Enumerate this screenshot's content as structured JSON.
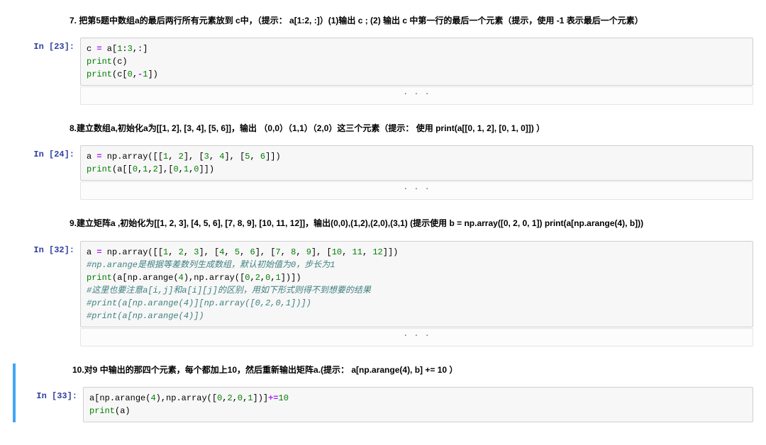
{
  "sections": [
    {
      "question": "7. 把第5题中数组a的最后两行所有元素放到 c中，（提示： a[1:2, :]）(1)输出 c ; (2) 输出 c 中第一行的最后一个元素（提示，使用 -1 表示最后一个元素）",
      "prompt": "In [23]:",
      "code_lines": [
        {
          "tokens": [
            {
              "t": "c ",
              "c": "nm"
            },
            {
              "t": "=",
              "c": "op"
            },
            {
              "t": " a[",
              "c": "nm"
            },
            {
              "t": "1",
              "c": "num"
            },
            {
              "t": ":",
              "c": "nm"
            },
            {
              "t": "3",
              "c": "num"
            },
            {
              "t": ",:]",
              "c": "nm"
            }
          ]
        },
        {
          "tokens": [
            {
              "t": "print",
              "c": "fn"
            },
            {
              "t": "(c)",
              "c": "nm"
            }
          ]
        },
        {
          "tokens": [
            {
              "t": "print",
              "c": "fn"
            },
            {
              "t": "(c[",
              "c": "nm"
            },
            {
              "t": "0",
              "c": "num"
            },
            {
              "t": ",",
              "c": "nm"
            },
            {
              "t": "-",
              "c": "op"
            },
            {
              "t": "1",
              "c": "num"
            },
            {
              "t": "])",
              "c": "nm"
            }
          ]
        }
      ],
      "collapsed": ". . ."
    },
    {
      "question": "8.建立数组a,初始化a为[[1, 2], [3, 4], [5, 6]]，输出 （0,0）（1,1）（2,0）这三个元素（提示： 使用 print(a[[0, 1, 2], [0, 1, 0]]) ）",
      "prompt": "In [24]:",
      "code_lines": [
        {
          "tokens": [
            {
              "t": "a ",
              "c": "nm"
            },
            {
              "t": "=",
              "c": "op"
            },
            {
              "t": " np",
              "c": "nm"
            },
            {
              "t": ".",
              "c": "nm"
            },
            {
              "t": "array([[",
              "c": "nm"
            },
            {
              "t": "1",
              "c": "num"
            },
            {
              "t": ", ",
              "c": "nm"
            },
            {
              "t": "2",
              "c": "num"
            },
            {
              "t": "], [",
              "c": "nm"
            },
            {
              "t": "3",
              "c": "num"
            },
            {
              "t": ", ",
              "c": "nm"
            },
            {
              "t": "4",
              "c": "num"
            },
            {
              "t": "], [",
              "c": "nm"
            },
            {
              "t": "5",
              "c": "num"
            },
            {
              "t": ", ",
              "c": "nm"
            },
            {
              "t": "6",
              "c": "num"
            },
            {
              "t": "]])",
              "c": "nm"
            }
          ]
        },
        {
          "tokens": [
            {
              "t": "print",
              "c": "fn"
            },
            {
              "t": "(a[[",
              "c": "nm"
            },
            {
              "t": "0",
              "c": "num"
            },
            {
              "t": ",",
              "c": "nm"
            },
            {
              "t": "1",
              "c": "num"
            },
            {
              "t": ",",
              "c": "nm"
            },
            {
              "t": "2",
              "c": "num"
            },
            {
              "t": "],[",
              "c": "nm"
            },
            {
              "t": "0",
              "c": "num"
            },
            {
              "t": ",",
              "c": "nm"
            },
            {
              "t": "1",
              "c": "num"
            },
            {
              "t": ",",
              "c": "nm"
            },
            {
              "t": "0",
              "c": "num"
            },
            {
              "t": "]])",
              "c": "nm"
            }
          ]
        }
      ],
      "collapsed": ". . ."
    },
    {
      "question": "9.建立矩阵a ,初始化为[[1, 2, 3], [4, 5, 6], [7, 8, 9], [10, 11, 12]]，输出(0,0),(1,2),(2,0),(3,1) (提示使用 b = np.array([0, 2, 0, 1]) print(a[np.arange(4), b]))",
      "prompt": "In [32]:",
      "code_lines": [
        {
          "tokens": [
            {
              "t": "a ",
              "c": "nm"
            },
            {
              "t": "=",
              "c": "op"
            },
            {
              "t": " np",
              "c": "nm"
            },
            {
              "t": ".",
              "c": "nm"
            },
            {
              "t": "array([[",
              "c": "nm"
            },
            {
              "t": "1",
              "c": "num"
            },
            {
              "t": ", ",
              "c": "nm"
            },
            {
              "t": "2",
              "c": "num"
            },
            {
              "t": ", ",
              "c": "nm"
            },
            {
              "t": "3",
              "c": "num"
            },
            {
              "t": "], [",
              "c": "nm"
            },
            {
              "t": "4",
              "c": "num"
            },
            {
              "t": ", ",
              "c": "nm"
            },
            {
              "t": "5",
              "c": "num"
            },
            {
              "t": ", ",
              "c": "nm"
            },
            {
              "t": "6",
              "c": "num"
            },
            {
              "t": "], [",
              "c": "nm"
            },
            {
              "t": "7",
              "c": "num"
            },
            {
              "t": ", ",
              "c": "nm"
            },
            {
              "t": "8",
              "c": "num"
            },
            {
              "t": ", ",
              "c": "nm"
            },
            {
              "t": "9",
              "c": "num"
            },
            {
              "t": "], [",
              "c": "nm"
            },
            {
              "t": "10",
              "c": "num"
            },
            {
              "t": ", ",
              "c": "nm"
            },
            {
              "t": "11",
              "c": "num"
            },
            {
              "t": ", ",
              "c": "nm"
            },
            {
              "t": "12",
              "c": "num"
            },
            {
              "t": "]])",
              "c": "nm"
            }
          ]
        },
        {
          "tokens": [
            {
              "t": "#np.arange是根据等差数列生成数组，默认初始值为0，步长为1",
              "c": "cm"
            }
          ]
        },
        {
          "tokens": [
            {
              "t": "print",
              "c": "fn"
            },
            {
              "t": "(a[np",
              "c": "nm"
            },
            {
              "t": ".",
              "c": "nm"
            },
            {
              "t": "arange(",
              "c": "nm"
            },
            {
              "t": "4",
              "c": "num"
            },
            {
              "t": "),np",
              "c": "nm"
            },
            {
              "t": ".",
              "c": "nm"
            },
            {
              "t": "array([",
              "c": "nm"
            },
            {
              "t": "0",
              "c": "num"
            },
            {
              "t": ",",
              "c": "nm"
            },
            {
              "t": "2",
              "c": "num"
            },
            {
              "t": ",",
              "c": "nm"
            },
            {
              "t": "0",
              "c": "num"
            },
            {
              "t": ",",
              "c": "nm"
            },
            {
              "t": "1",
              "c": "num"
            },
            {
              "t": "])])",
              "c": "nm"
            }
          ]
        },
        {
          "tokens": [
            {
              "t": "#这里也要注意a[i,j]和a[i][j]的区别，用如下形式则得不到想要的结果",
              "c": "cm"
            }
          ]
        },
        {
          "tokens": [
            {
              "t": "#print(a[np.arange(4)][np.array([0,2,0,1])])",
              "c": "cm"
            }
          ]
        },
        {
          "tokens": [
            {
              "t": "#print(a[np.arange(4)])",
              "c": "cm"
            }
          ]
        }
      ],
      "collapsed": ". . ."
    },
    {
      "question": "10.对9 中输出的那四个元素，每个都加上10，然后重新输出矩阵a.(提示： a[np.arange(4), b] += 10 ）",
      "prompt": "In [33]:",
      "code_lines": [
        {
          "tokens": [
            {
              "t": "a[np",
              "c": "nm"
            },
            {
              "t": ".",
              "c": "nm"
            },
            {
              "t": "arange(",
              "c": "nm"
            },
            {
              "t": "4",
              "c": "num"
            },
            {
              "t": "),np",
              "c": "nm"
            },
            {
              "t": ".",
              "c": "nm"
            },
            {
              "t": "array([",
              "c": "nm"
            },
            {
              "t": "0",
              "c": "num"
            },
            {
              "t": ",",
              "c": "nm"
            },
            {
              "t": "2",
              "c": "num"
            },
            {
              "t": ",",
              "c": "nm"
            },
            {
              "t": "0",
              "c": "num"
            },
            {
              "t": ",",
              "c": "nm"
            },
            {
              "t": "1",
              "c": "num"
            },
            {
              "t": "])]",
              "c": "nm"
            },
            {
              "t": "+=",
              "c": "op"
            },
            {
              "t": "10",
              "c": "num"
            }
          ]
        },
        {
          "tokens": [
            {
              "t": "print",
              "c": "fn"
            },
            {
              "t": "(a)",
              "c": "nm"
            }
          ]
        }
      ],
      "active": true
    }
  ]
}
